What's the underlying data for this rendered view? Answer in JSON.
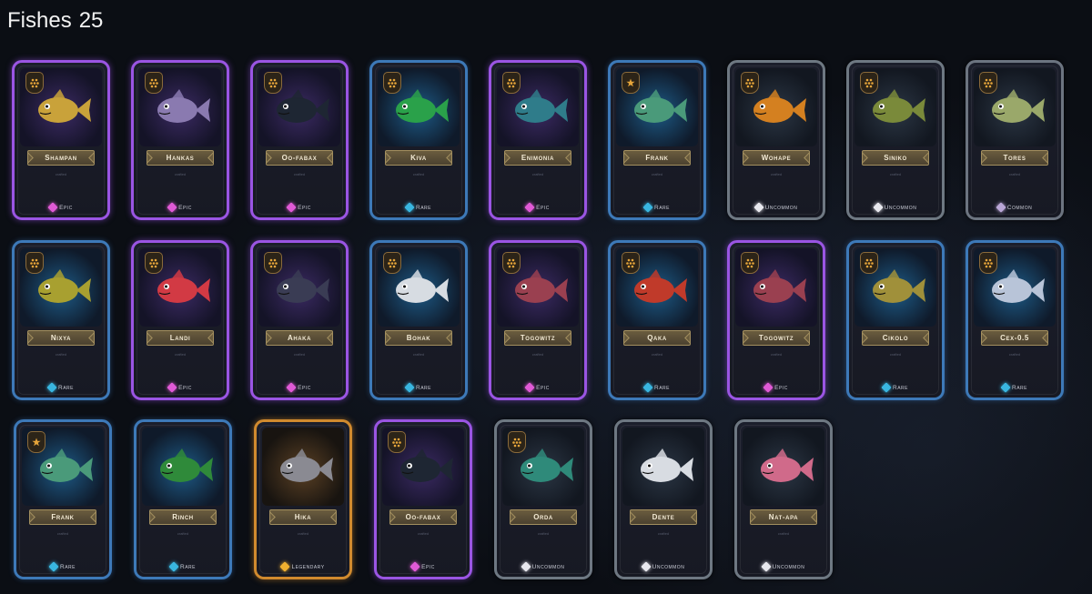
{
  "header": {
    "title": "Fishes",
    "count": "25"
  },
  "rarity_colors": {
    "Epic": "#e05ad6",
    "Rare": "#39b6e0",
    "Uncommon": "#e8e8ee",
    "Common": "#b9a6d6",
    "Legendary": "#f0b030"
  },
  "cards": [
    {
      "name": "Shampan",
      "rarity": "Epic",
      "badge": "dots",
      "subtext": "crafted",
      "fish_color": "#c9a23a",
      "icon": "fish-icon"
    },
    {
      "name": "Hankas",
      "rarity": "Epic",
      "badge": "dots",
      "subtext": "crafted",
      "fish_color": "#8a7ab0",
      "icon": "fish-icon"
    },
    {
      "name": "Oo-fabax",
      "rarity": "Epic",
      "badge": "dots",
      "subtext": "crafted",
      "fish_color": "#1e2633",
      "icon": "orca-icon"
    },
    {
      "name": "Kiva",
      "rarity": "Rare",
      "badge": "dots",
      "subtext": "crafted",
      "fish_color": "#2aa14a",
      "icon": "fish-icon"
    },
    {
      "name": "Enimonia",
      "rarity": "Epic",
      "badge": "dots",
      "subtext": "crafted",
      "fish_color": "#2f7c8a",
      "icon": "fish-icon"
    },
    {
      "name": "Frank",
      "rarity": "Rare",
      "badge": "star",
      "subtext": "crafted",
      "fish_color": "#4a9a7a",
      "icon": "fish-icon"
    },
    {
      "name": "Wohape",
      "rarity": "Uncommon",
      "badge": "dots",
      "subtext": "crafted",
      "fish_color": "#d48020",
      "icon": "fish-icon"
    },
    {
      "name": "Siniko",
      "rarity": "Uncommon",
      "badge": "dots",
      "subtext": "crafted",
      "fish_color": "#7a8a3a",
      "icon": "fish-icon"
    },
    {
      "name": "Tores",
      "rarity": "Common",
      "badge": "dots",
      "subtext": "crafted",
      "fish_color": "#9aa86a",
      "icon": "fish-icon"
    },
    {
      "name": "Nixya",
      "rarity": "Rare",
      "badge": "dots",
      "subtext": "crafted",
      "fish_color": "#a8a030",
      "icon": "shark-icon"
    },
    {
      "name": "Landi",
      "rarity": "Epic",
      "badge": "dots",
      "subtext": "crafted",
      "fish_color": "#d23a44",
      "icon": "fish-icon"
    },
    {
      "name": "Ahaka",
      "rarity": "Epic",
      "badge": "dots",
      "subtext": "crafted",
      "fish_color": "#3a3c54",
      "icon": "fish-icon"
    },
    {
      "name": "Bohak",
      "rarity": "Rare",
      "badge": "dots",
      "subtext": "crafted",
      "fish_color": "#d7dce2",
      "icon": "fish-icon"
    },
    {
      "name": "Togowitz",
      "rarity": "Epic",
      "badge": "dots",
      "subtext": "crafted",
      "fish_color": "#9a4050",
      "icon": "dragon-icon"
    },
    {
      "name": "Qaka",
      "rarity": "Rare",
      "badge": "dots",
      "subtext": "crafted",
      "fish_color": "#c03a2a",
      "icon": "dragon-icon"
    },
    {
      "name": "Togowitz",
      "rarity": "Epic",
      "badge": "dots",
      "subtext": "crafted",
      "fish_color": "#9a4050",
      "icon": "dragon-icon"
    },
    {
      "name": "Cikolo",
      "rarity": "Rare",
      "badge": "dots",
      "subtext": "crafted",
      "fish_color": "#a0903a",
      "icon": "fish-icon"
    },
    {
      "name": "Cex-0.5",
      "rarity": "Rare",
      "badge": "dots",
      "subtext": "crafted",
      "fish_color": "#b8c4d8",
      "icon": "shark-icon"
    },
    {
      "name": "Frank",
      "rarity": "Rare",
      "badge": "star",
      "subtext": "crafted",
      "fish_color": "#4a9a7a",
      "icon": "fish-icon"
    },
    {
      "name": "Rinch",
      "rarity": "Rare",
      "badge": "none",
      "subtext": "crafted",
      "fish_color": "#2f8a3a",
      "icon": "fish-icon"
    },
    {
      "name": "Hika",
      "rarity": "Legendary",
      "badge": "none",
      "subtext": "crafted",
      "fish_color": "#8a8a92",
      "icon": "whale-icon"
    },
    {
      "name": "Oo-fabax",
      "rarity": "Epic",
      "badge": "dots",
      "subtext": "crafted",
      "fish_color": "#1e2633",
      "icon": "orca-icon"
    },
    {
      "name": "Orda",
      "rarity": "Uncommon",
      "badge": "dots",
      "subtext": "crafted",
      "fish_color": "#2f8a7a",
      "icon": "fish-icon"
    },
    {
      "name": "Dente",
      "rarity": "Uncommon",
      "badge": "none",
      "subtext": "crafted",
      "fish_color": "#d8dce2",
      "icon": "fish-icon"
    },
    {
      "name": "Nat-apa",
      "rarity": "Uncommon",
      "badge": "none",
      "subtext": "crafted",
      "fish_color": "#d06a8a",
      "icon": "fish-icon"
    }
  ]
}
